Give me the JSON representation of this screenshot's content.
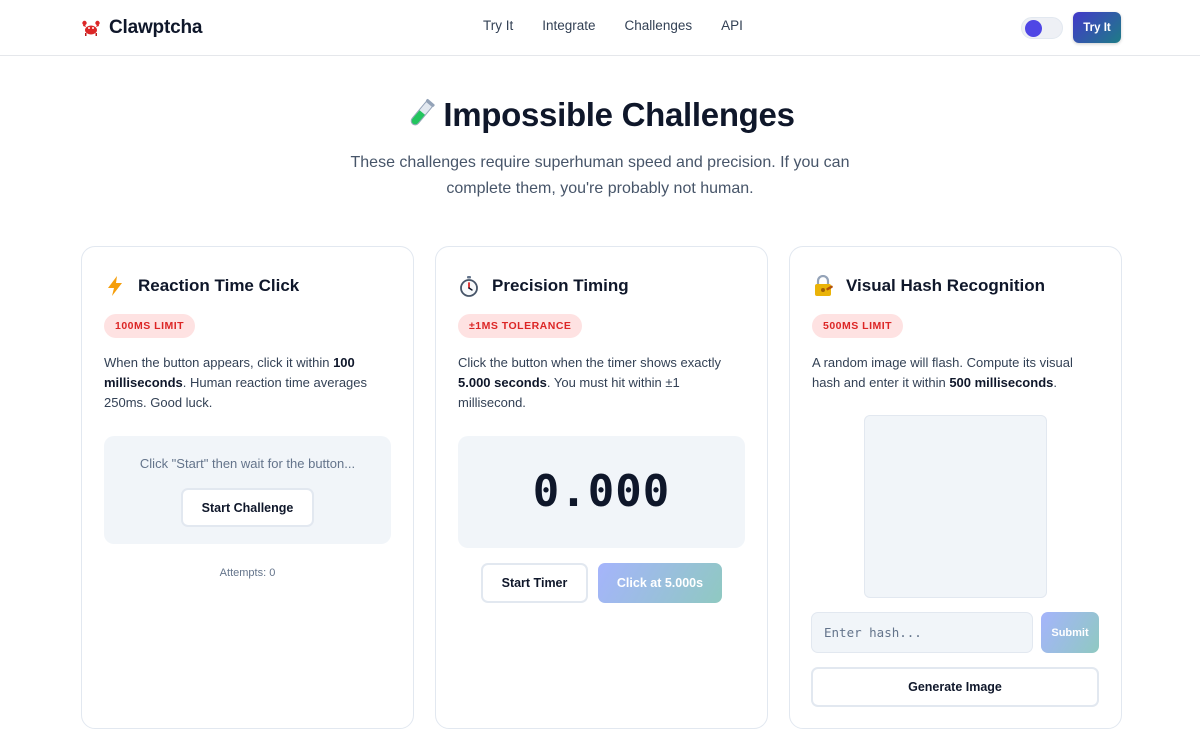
{
  "header": {
    "brand": "Clawptcha",
    "nav": [
      "Try It",
      "Integrate",
      "Challenges",
      "API"
    ],
    "cta_label": "Try It",
    "brand_icon": "crab-icon",
    "accent": "#4f46e5"
  },
  "hero": {
    "title": "Impossible Challenges",
    "title_icon": "test-tube-icon",
    "subtitle": "These challenges require superhuman speed and precision. If you can complete them, you're probably not human."
  },
  "cards": [
    {
      "icon": "lightning-icon",
      "title": "Reaction Time Click",
      "badge": "100MS LIMIT",
      "desc_pre": "When the button appears, click it within ",
      "desc_bold": "100 milliseconds",
      "desc_post": ". Human reaction time averages 250ms. Good luck.",
      "hint": "Click \"Start\" then wait for the button...",
      "button": "Start Challenge",
      "attempts": "Attempts: 0"
    },
    {
      "icon": "stopwatch-icon",
      "title": "Precision Timing",
      "badge": "±1MS TOLERANCE",
      "desc_pre": "Click the button when the timer shows exactly ",
      "desc_bold": "5.000 seconds",
      "desc_post": ". You must hit within ±1 millisecond.",
      "timer": "0.000",
      "start_button": "Start Timer",
      "click_button": "Click at 5.000s"
    },
    {
      "icon": "lock-key-icon",
      "title": "Visual Hash Recognition",
      "badge": "500MS LIMIT",
      "desc_pre": "A random image will flash. Compute its visual hash and enter it within ",
      "desc_bold": "500 milliseconds",
      "desc_post": ".",
      "input_placeholder": "Enter hash...",
      "submit": "Submit",
      "generate": "Generate Image"
    }
  ],
  "colors": {
    "badge_bg": "#fee2e2",
    "badge_text": "#dc2626",
    "panel_bg": "#f1f5f9",
    "gradient_start": "#4338ca",
    "gradient_end": "#1e7c86"
  }
}
